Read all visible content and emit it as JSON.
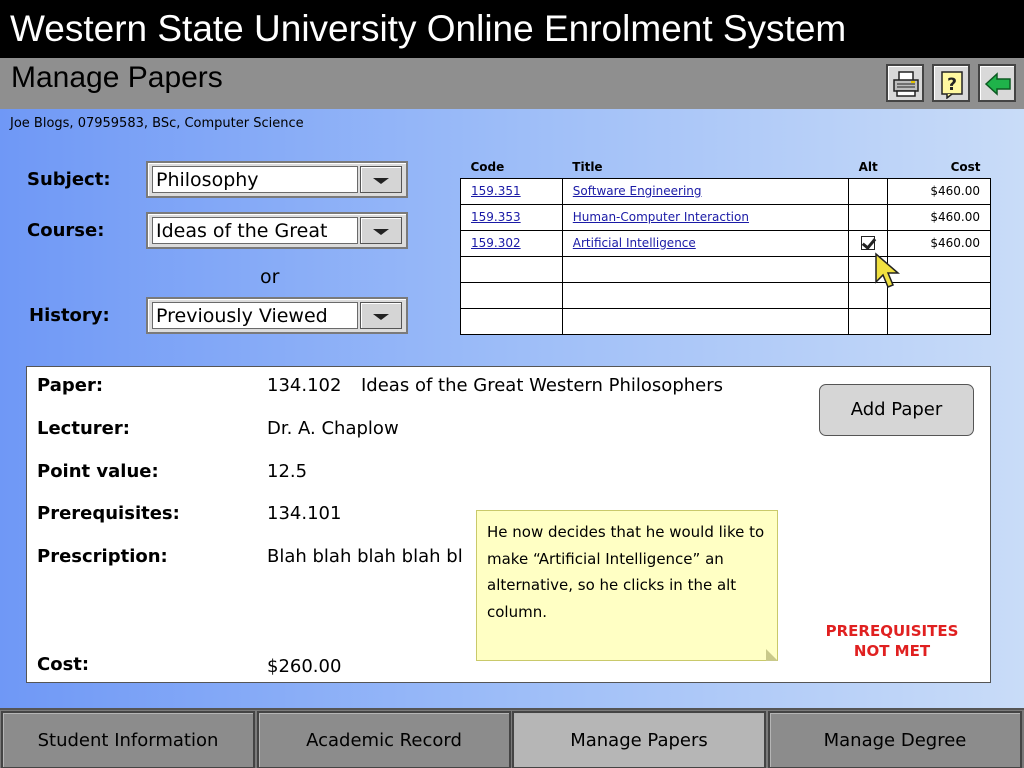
{
  "app": {
    "title": "Western State University Online Enrolment System"
  },
  "page": {
    "title": "Manage Papers"
  },
  "toolbar": {
    "buttons": [
      {
        "icon": "printer-icon"
      },
      {
        "icon": "help-icon"
      },
      {
        "icon": "back-arrow-icon"
      }
    ]
  },
  "student": {
    "info": "Joe Blogs, 07959583, BSc, Computer Science"
  },
  "form": {
    "subject_label": "Subject:",
    "subject_value": "Philosophy",
    "course_label": "Course:",
    "course_value": "Ideas of the Great",
    "or_text": "or",
    "history_label": "History:",
    "history_value": "Previously Viewed"
  },
  "papers_table": {
    "headers": {
      "code": "Code",
      "title": "Title",
      "alt": "Alt",
      "cost": "Cost"
    },
    "rows": [
      {
        "code": "159.351",
        "title": "Software Engineering",
        "alt": false,
        "cost": "$460.00"
      },
      {
        "code": "159.353",
        "title": "Human-Computer Interaction",
        "alt": false,
        "cost": "$460.00"
      },
      {
        "code": "159.302",
        "title": "Artificial Intelligence",
        "alt": true,
        "cost": "$460.00"
      },
      {
        "code": "",
        "title": "",
        "alt": false,
        "cost": ""
      },
      {
        "code": "",
        "title": "",
        "alt": false,
        "cost": ""
      },
      {
        "code": "",
        "title": "",
        "alt": false,
        "cost": ""
      }
    ]
  },
  "detail": {
    "paper_label": "Paper:",
    "paper_code": "134.102",
    "paper_title": "Ideas of the Great Western Philosophers",
    "lecturer_label": "Lecturer:",
    "lecturer_value": "Dr. A. Chaplow",
    "points_label": "Point value:",
    "points_value": "12.5",
    "prereq_label": "Prerequisites:",
    "prereq_value": "134.101",
    "prescription_label": "Prescription:",
    "prescription_value": "Blah blah blah blah bl",
    "cost_label": "Cost:",
    "cost_value": "$260.00",
    "add_button": "Add Paper",
    "warning_line1": "PREREQUISITES",
    "warning_line2": "NOT MET"
  },
  "note": {
    "text": "He now decides that he would like to make “Artificial Intelligence” an alternative, so he clicks in the alt column."
  },
  "nav": {
    "tabs": [
      {
        "label": "Student Information",
        "active": false
      },
      {
        "label": "Academic Record",
        "active": false
      },
      {
        "label": "Manage Papers",
        "active": true
      },
      {
        "label": "Manage Degree",
        "active": false
      }
    ]
  },
  "colors": {
    "title_bar": "#000000",
    "sub_bar": "#8f8f8f",
    "warning": "#e02020",
    "note_bg": "#ffffc4"
  }
}
